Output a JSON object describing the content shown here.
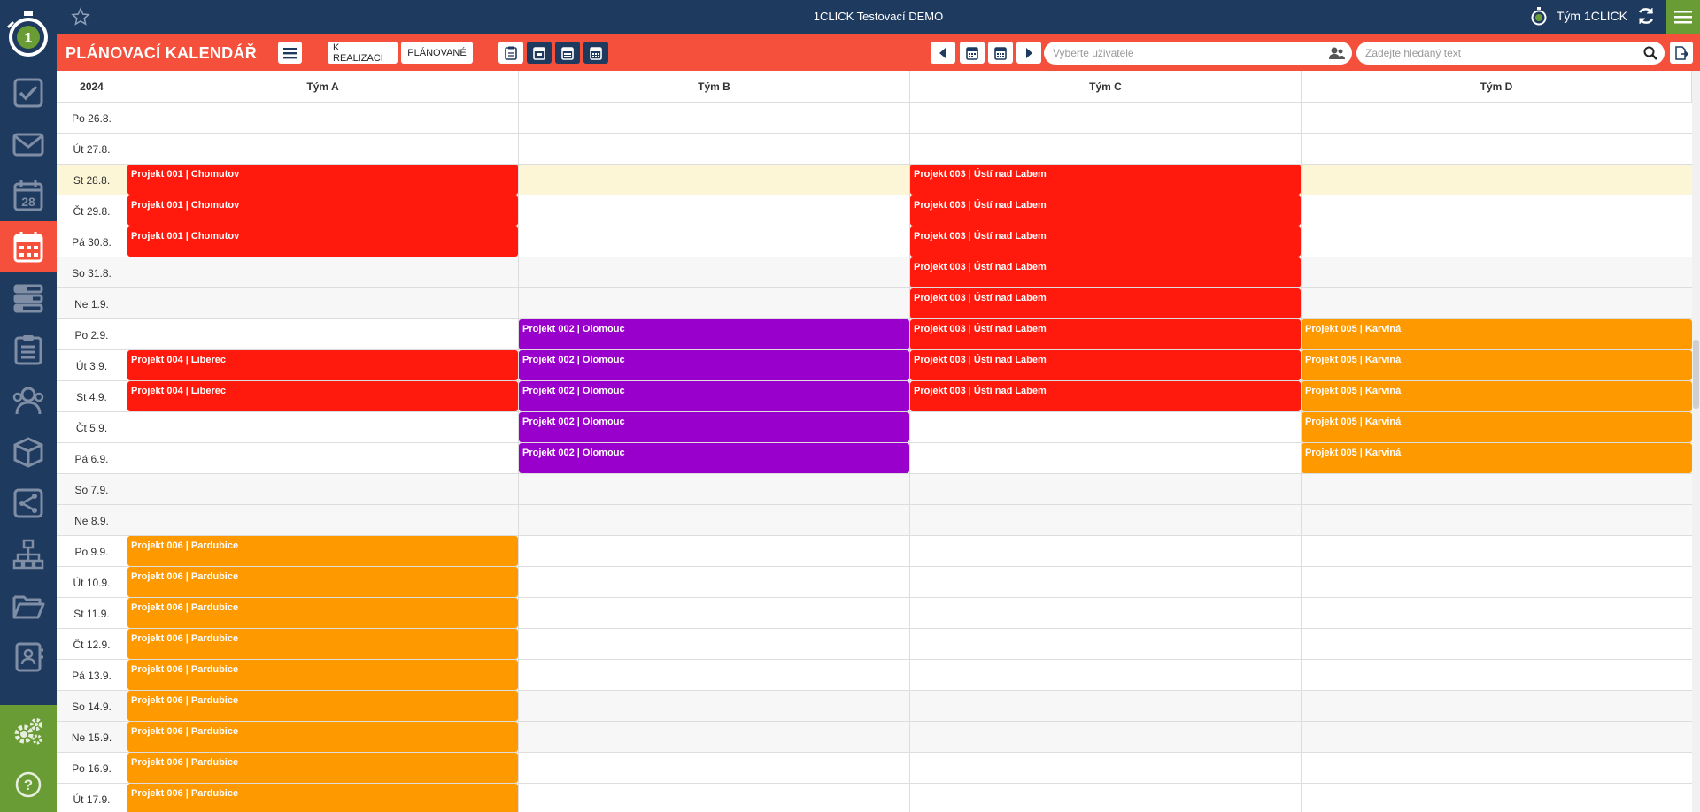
{
  "app": {
    "window_title": "1CLICK Testovací DEMO",
    "team_label": "Tým 1CLICK",
    "page_title": "PLÁNOVACÍ KALENDÁŘ"
  },
  "colors": {
    "navy": "#1f3a5f",
    "accent_red": "#f4503c",
    "green": "#6a9c36",
    "event_red": "#ff1a0d",
    "event_purple": "#9900cc",
    "event_orange": "#ff9900"
  },
  "sidebar": {
    "items": [
      {
        "icon": "check-square-icon"
      },
      {
        "icon": "envelope-icon"
      },
      {
        "icon": "calendar-28-icon",
        "text": "28"
      },
      {
        "icon": "planning-calendar-icon",
        "active": true
      },
      {
        "icon": "gantt-bars-icon"
      },
      {
        "icon": "clipboard-list-icon"
      },
      {
        "icon": "users-icon"
      },
      {
        "icon": "box-icon"
      },
      {
        "icon": "workflow-icon"
      },
      {
        "icon": "org-chart-icon"
      },
      {
        "icon": "folder-open-icon"
      },
      {
        "icon": "contacts-book-icon"
      }
    ],
    "bottom": [
      "settings-gears-icon",
      "help-icon"
    ]
  },
  "toolbar": {
    "filter_k_realizaci": "K REALIZACI",
    "filter_planovane": "PLÁNOVANÉ",
    "user_placeholder": "Vyberte uživatele",
    "search_placeholder": "Zadejte hledaný text"
  },
  "calendar": {
    "year": "2024",
    "columns": [
      "Tým A",
      "Tým B",
      "Tým C",
      "Tým D"
    ],
    "rows": [
      {
        "day": "Po 26.8.",
        "events": [
          null,
          null,
          null,
          null
        ]
      },
      {
        "day": "Út 27.8.",
        "events": [
          null,
          null,
          null,
          null
        ]
      },
      {
        "day": "St 28.8.",
        "today": true,
        "events": [
          {
            "label": "Projekt 001 | Chomutov",
            "color": "red"
          },
          null,
          {
            "label": "Projekt 003 | Ústí nad Labem",
            "color": "red"
          },
          null
        ]
      },
      {
        "day": "Čt 29.8.",
        "events": [
          {
            "label": "Projekt 001 | Chomutov",
            "color": "red"
          },
          null,
          {
            "label": "Projekt 003 | Ústí nad Labem",
            "color": "red"
          },
          null
        ]
      },
      {
        "day": "Pá 30.8.",
        "events": [
          {
            "label": "Projekt 001 | Chomutov",
            "color": "red"
          },
          null,
          {
            "label": "Projekt 003 | Ústí nad Labem",
            "color": "red"
          },
          null
        ]
      },
      {
        "day": "So 31.8.",
        "weekend": true,
        "events": [
          null,
          null,
          {
            "label": "Projekt 003 | Ústí nad Labem",
            "color": "red"
          },
          null
        ]
      },
      {
        "day": "Ne 1.9.",
        "weekend": true,
        "events": [
          null,
          null,
          {
            "label": "Projekt 003 | Ústí nad Labem",
            "color": "red"
          },
          null
        ]
      },
      {
        "day": "Po 2.9.",
        "events": [
          null,
          {
            "label": "Projekt 002 | Olomouc",
            "color": "purple"
          },
          {
            "label": "Projekt 003 | Ústí nad Labem",
            "color": "red"
          },
          {
            "label": "Projekt 005 | Karviná",
            "color": "orange"
          }
        ]
      },
      {
        "day": "Út 3.9.",
        "events": [
          {
            "label": "Projekt 004 | Liberec",
            "color": "red"
          },
          {
            "label": "Projekt 002 | Olomouc",
            "color": "purple"
          },
          {
            "label": "Projekt 003 | Ústí nad Labem",
            "color": "red"
          },
          {
            "label": "Projekt 005 | Karviná",
            "color": "orange"
          }
        ]
      },
      {
        "day": "St 4.9.",
        "events": [
          {
            "label": "Projekt 004 | Liberec",
            "color": "red"
          },
          {
            "label": "Projekt 002 | Olomouc",
            "color": "purple"
          },
          {
            "label": "Projekt 003 | Ústí nad Labem",
            "color": "red"
          },
          {
            "label": "Projekt 005 | Karviná",
            "color": "orange"
          }
        ]
      },
      {
        "day": "Čt 5.9.",
        "events": [
          null,
          {
            "label": "Projekt 002 | Olomouc",
            "color": "purple"
          },
          null,
          {
            "label": "Projekt 005 | Karviná",
            "color": "orange"
          }
        ]
      },
      {
        "day": "Pá 6.9.",
        "events": [
          null,
          {
            "label": "Projekt 002 | Olomouc",
            "color": "purple"
          },
          null,
          {
            "label": "Projekt 005 | Karviná",
            "color": "orange"
          }
        ]
      },
      {
        "day": "So 7.9.",
        "weekend": true,
        "events": [
          null,
          null,
          null,
          null
        ]
      },
      {
        "day": "Ne 8.9.",
        "weekend": true,
        "events": [
          null,
          null,
          null,
          null
        ]
      },
      {
        "day": "Po 9.9.",
        "events": [
          {
            "label": "Projekt 006 | Pardubice",
            "color": "orange"
          },
          null,
          null,
          null
        ]
      },
      {
        "day": "Út 10.9.",
        "events": [
          {
            "label": "Projekt 006 | Pardubice",
            "color": "orange"
          },
          null,
          null,
          null
        ]
      },
      {
        "day": "St 11.9.",
        "events": [
          {
            "label": "Projekt 006 | Pardubice",
            "color": "orange"
          },
          null,
          null,
          null
        ]
      },
      {
        "day": "Čt 12.9.",
        "events": [
          {
            "label": "Projekt 006 | Pardubice",
            "color": "orange"
          },
          null,
          null,
          null
        ]
      },
      {
        "day": "Pá 13.9.",
        "events": [
          {
            "label": "Projekt 006 | Pardubice",
            "color": "orange"
          },
          null,
          null,
          null
        ]
      },
      {
        "day": "So 14.9.",
        "weekend": true,
        "events": [
          {
            "label": "Projekt 006 | Pardubice",
            "color": "orange"
          },
          null,
          null,
          null
        ]
      },
      {
        "day": "Ne 15.9.",
        "weekend": true,
        "events": [
          {
            "label": "Projekt 006 | Pardubice",
            "color": "orange"
          },
          null,
          null,
          null
        ]
      },
      {
        "day": "Po 16.9.",
        "events": [
          {
            "label": "Projekt 006 | Pardubice",
            "color": "orange"
          },
          null,
          null,
          null
        ]
      },
      {
        "day": "Út 17.9.",
        "events": [
          {
            "label": "Projekt 006 | Pardubice",
            "color": "orange"
          },
          null,
          null,
          null
        ]
      }
    ]
  }
}
